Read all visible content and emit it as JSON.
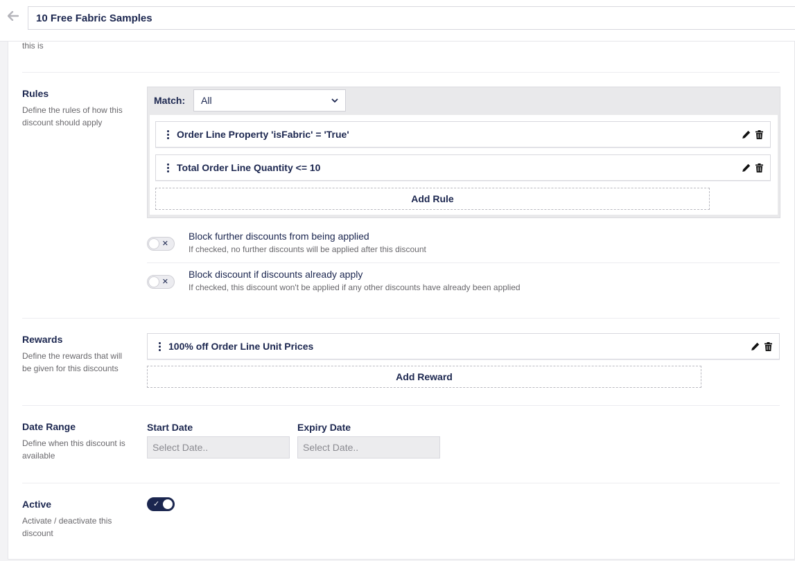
{
  "header": {
    "title_value": "10 Free Fabric Samples"
  },
  "intro": {
    "desc_tail": "this is"
  },
  "rules": {
    "label": "Rules",
    "description": "Define the rules of how this discount should apply",
    "match_label": "Match:",
    "match_value": "All",
    "items": [
      {
        "text": "Order Line Property 'isFabric' = 'True'"
      },
      {
        "text": "Total Order Line Quantity <= 10"
      }
    ],
    "add_label": "Add Rule"
  },
  "options": [
    {
      "title": "Block further discounts from being applied",
      "description": "If checked, no further discounts will be applied after this discount",
      "checked": false
    },
    {
      "title": "Block discount if discounts already apply",
      "description": "If checked, this discount won't be applied if any other discounts have already been applied",
      "checked": false
    }
  ],
  "rewards": {
    "label": "Rewards",
    "description": "Define the rewards that will be given for this discounts",
    "items": [
      {
        "text": "100% off Order Line Unit Prices"
      }
    ],
    "add_label": "Add Reward"
  },
  "date_range": {
    "label": "Date Range",
    "description": "Define when this discount is available",
    "start_label": "Start Date",
    "start_placeholder": "Select Date..",
    "expiry_label": "Expiry Date",
    "expiry_placeholder": "Select Date.."
  },
  "active": {
    "label": "Active",
    "description": "Activate / deactivate this discount",
    "checked": true
  },
  "icons": {
    "back": "arrow-left-icon",
    "edit": "pencil-icon",
    "delete": "trash-icon",
    "drag": "drag-handle-icon",
    "dropdown": "chevron-down-icon"
  },
  "colors": {
    "primary": "#1b264f",
    "muted_text": "#68676b",
    "background": "#f3f3f5"
  }
}
